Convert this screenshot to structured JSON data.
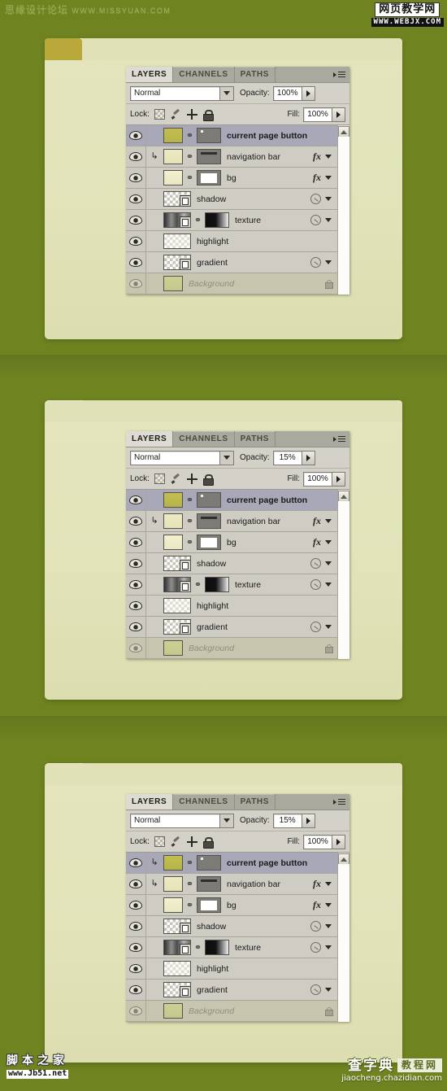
{
  "watermarks": {
    "top_left_cn": "思缘设计论坛",
    "top_left_url": "WWW.MISSYUAN.COM",
    "top_right_cn": "网页教学网",
    "top_right_url": "WWW.WEBJX.COM",
    "bottom_left_cn": "脚本之家",
    "bottom_left_url": "www.Jb51.net",
    "bottom_right_cn1": "查字典",
    "bottom_right_cn2": "教程网",
    "bottom_right_url": "jiaocheng.chazidian.com"
  },
  "panels": [
    {
      "tabs": [
        {
          "label": "LAYERS",
          "active": true
        },
        {
          "label": "CHANNELS",
          "active": false
        },
        {
          "label": "PATHS",
          "active": false
        }
      ],
      "blend_mode": "Normal",
      "opacity_label": "Opacity:",
      "opacity_value": "100%",
      "lock_label": "Lock:",
      "fill_label": "Fill:",
      "fill_value": "100%",
      "lock_icons": [
        "lock-transparent-pixels-icon",
        "lock-image-pixels-icon",
        "lock-position-icon",
        "lock-all-icon"
      ],
      "layers": [
        {
          "name": "current page button",
          "selected": true,
          "clipped": false,
          "visible": true,
          "bold": true,
          "thumb": "olive",
          "link": true,
          "mask": "graydot",
          "fx": false,
          "fx_circle": false,
          "caret": false
        },
        {
          "name": "navigation bar",
          "selected": false,
          "clipped": true,
          "visible": true,
          "bold": false,
          "thumb": "cream",
          "link": true,
          "mask": "grayline",
          "fx": true,
          "fx_circle": false,
          "caret": true
        },
        {
          "name": "bg",
          "selected": false,
          "clipped": false,
          "visible": true,
          "bold": false,
          "thumb": "cream2",
          "link": true,
          "mask": "whitebox",
          "fx": true,
          "fx_circle": false,
          "caret": true
        },
        {
          "name": "shadow",
          "selected": false,
          "clipped": false,
          "visible": true,
          "bold": false,
          "thumb": "checker-smart",
          "link": false,
          "mask": "none",
          "fx": false,
          "fx_circle": true,
          "caret": true
        },
        {
          "name": "texture",
          "selected": false,
          "clipped": false,
          "visible": true,
          "bold": false,
          "thumb": "texgrad-smart",
          "link": true,
          "mask": "bw",
          "fx": false,
          "fx_circle": true,
          "caret": true
        },
        {
          "name": "highlight",
          "selected": false,
          "clipped": false,
          "visible": true,
          "bold": false,
          "thumb": "checkerlite",
          "link": false,
          "mask": "none",
          "fx": false,
          "fx_circle": false,
          "caret": false
        },
        {
          "name": "gradient",
          "selected": false,
          "clipped": false,
          "visible": true,
          "bold": false,
          "thumb": "checker-smart",
          "link": false,
          "mask": "none",
          "fx": false,
          "fx_circle": true,
          "caret": true
        },
        {
          "name": "Background",
          "selected": false,
          "clipped": false,
          "visible": false,
          "bold": false,
          "background_row": true,
          "thumb": "bggreen",
          "link": false,
          "mask": "none",
          "fx": false,
          "fx_circle": false,
          "caret": false,
          "locked": true
        }
      ]
    },
    {
      "tabs": [
        {
          "label": "LAYERS",
          "active": true
        },
        {
          "label": "CHANNELS",
          "active": false
        },
        {
          "label": "PATHS",
          "active": false
        }
      ],
      "blend_mode": "Normal",
      "opacity_label": "Opacity:",
      "opacity_value": "15%",
      "lock_label": "Lock:",
      "fill_label": "Fill:",
      "fill_value": "100%",
      "lock_icons": [
        "lock-transparent-pixels-icon",
        "lock-image-pixels-icon",
        "lock-position-icon",
        "lock-all-icon"
      ],
      "layers": [
        {
          "name": "current page button",
          "selected": true,
          "clipped": false,
          "visible": true,
          "bold": true,
          "thumb": "olive",
          "link": true,
          "mask": "graydot",
          "fx": false,
          "fx_circle": false,
          "caret": false
        },
        {
          "name": "navigation bar",
          "selected": false,
          "clipped": true,
          "visible": true,
          "bold": false,
          "thumb": "cream",
          "link": true,
          "mask": "grayline",
          "fx": true,
          "fx_circle": false,
          "caret": true
        },
        {
          "name": "bg",
          "selected": false,
          "clipped": false,
          "visible": true,
          "bold": false,
          "thumb": "cream2",
          "link": true,
          "mask": "whitebox",
          "fx": true,
          "fx_circle": false,
          "caret": true
        },
        {
          "name": "shadow",
          "selected": false,
          "clipped": false,
          "visible": true,
          "bold": false,
          "thumb": "checker-smart",
          "link": false,
          "mask": "none",
          "fx": false,
          "fx_circle": true,
          "caret": true
        },
        {
          "name": "texture",
          "selected": false,
          "clipped": false,
          "visible": true,
          "bold": false,
          "thumb": "texgrad-smart",
          "link": true,
          "mask": "bw",
          "fx": false,
          "fx_circle": true,
          "caret": true
        },
        {
          "name": "highlight",
          "selected": false,
          "clipped": false,
          "visible": true,
          "bold": false,
          "thumb": "checkerlite",
          "link": false,
          "mask": "none",
          "fx": false,
          "fx_circle": false,
          "caret": false
        },
        {
          "name": "gradient",
          "selected": false,
          "clipped": false,
          "visible": true,
          "bold": false,
          "thumb": "checker-smart",
          "link": false,
          "mask": "none",
          "fx": false,
          "fx_circle": true,
          "caret": true
        },
        {
          "name": "Background",
          "selected": false,
          "clipped": false,
          "visible": false,
          "bold": false,
          "background_row": true,
          "thumb": "bggreen",
          "link": false,
          "mask": "none",
          "fx": false,
          "fx_circle": false,
          "caret": false,
          "locked": true
        }
      ]
    },
    {
      "tabs": [
        {
          "label": "LAYERS",
          "active": true
        },
        {
          "label": "CHANNELS",
          "active": false
        },
        {
          "label": "PATHS",
          "active": false
        }
      ],
      "blend_mode": "Normal",
      "opacity_label": "Opacity:",
      "opacity_value": "15%",
      "lock_label": "Lock:",
      "fill_label": "Fill:",
      "fill_value": "100%",
      "lock_icons": [
        "lock-transparent-pixels-icon",
        "lock-image-pixels-icon",
        "lock-position-icon",
        "lock-all-icon"
      ],
      "layers": [
        {
          "name": "current page button",
          "selected": true,
          "clipped": true,
          "visible": true,
          "bold": true,
          "thumb": "olive",
          "link": true,
          "mask": "graydot",
          "fx": false,
          "fx_circle": false,
          "caret": false
        },
        {
          "name": "navigation bar",
          "selected": false,
          "clipped": true,
          "visible": true,
          "bold": false,
          "thumb": "cream",
          "link": true,
          "mask": "grayline",
          "fx": true,
          "fx_circle": false,
          "caret": true
        },
        {
          "name": "bg",
          "selected": false,
          "clipped": false,
          "visible": true,
          "bold": false,
          "thumb": "cream2",
          "link": true,
          "mask": "whitebox",
          "fx": true,
          "fx_circle": false,
          "caret": true
        },
        {
          "name": "shadow",
          "selected": false,
          "clipped": false,
          "visible": true,
          "bold": false,
          "thumb": "checker-smart",
          "link": false,
          "mask": "none",
          "fx": false,
          "fx_circle": true,
          "caret": true
        },
        {
          "name": "texture",
          "selected": false,
          "clipped": false,
          "visible": true,
          "bold": false,
          "thumb": "texgrad-smart",
          "link": true,
          "mask": "bw",
          "fx": false,
          "fx_circle": true,
          "caret": true
        },
        {
          "name": "highlight",
          "selected": false,
          "clipped": false,
          "visible": true,
          "bold": false,
          "thumb": "checkerlite",
          "link": false,
          "mask": "none",
          "fx": false,
          "fx_circle": false,
          "caret": false
        },
        {
          "name": "gradient",
          "selected": false,
          "clipped": false,
          "visible": true,
          "bold": false,
          "thumb": "checker-smart",
          "link": false,
          "mask": "none",
          "fx": false,
          "fx_circle": true,
          "caret": true
        },
        {
          "name": "Background",
          "selected": false,
          "clipped": false,
          "visible": false,
          "bold": false,
          "background_row": true,
          "thumb": "bggreen",
          "link": false,
          "mask": "none",
          "fx": false,
          "fx_circle": false,
          "caret": false,
          "locked": true
        }
      ]
    }
  ],
  "mock_pages": [
    {
      "tab_color": "#b9a93a",
      "navbar_color": "#e0e1b6",
      "tab_opacity": 1
    },
    {
      "tab_color": "#d3d39c",
      "navbar_color": "#e0e1b6",
      "tab_opacity": 0.2
    },
    {
      "tab_color": "#d3d39c",
      "navbar_color": "#e0e1b6",
      "tab_opacity": 0.2
    }
  ],
  "colors": {
    "background_green": "#748a2b",
    "card_cream": "#e2e3b9",
    "panel_gray": "#cfccc3",
    "selected_row": "#a9a8b8"
  }
}
